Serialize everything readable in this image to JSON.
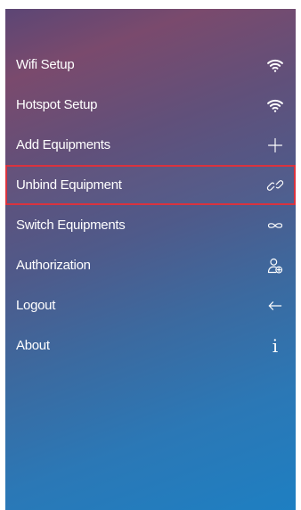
{
  "menu": {
    "items": [
      {
        "label": "Wifi Setup",
        "icon": "wifi-icon"
      },
      {
        "label": "Hotspot Setup",
        "icon": "wifi-icon"
      },
      {
        "label": "Add Equipments",
        "icon": "plus-icon"
      },
      {
        "label": "Unbind Equipment",
        "icon": "unlink-icon",
        "selected": true
      },
      {
        "label": "Switch Equipments",
        "icon": "infinity-icon"
      },
      {
        "label": "Authorization",
        "icon": "user-add-icon"
      },
      {
        "label": "Logout",
        "icon": "arrow-left-icon"
      },
      {
        "label": "About",
        "icon": "info-icon",
        "glyph": "i"
      }
    ]
  },
  "colors": {
    "selected_border": "#d9333f",
    "text": "#ffffff"
  }
}
